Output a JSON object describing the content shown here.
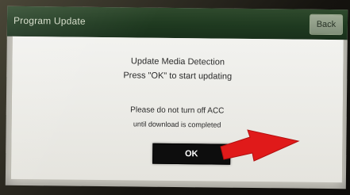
{
  "titlebar": {
    "title": "Program Update",
    "back_label": "Back"
  },
  "dialog": {
    "line1": "Update Media Detection",
    "line2": "Press \"OK\" to start updating",
    "line3": "Please do not turn off ACC",
    "line4": "until download is completed",
    "ok_label": "OK"
  },
  "colors": {
    "titlebar": "#1f3a20",
    "dialog_bg": "#f0f0ee",
    "ok_button": "#0d0d0d",
    "arrow": "#e01a1a"
  },
  "icons": {
    "annotation": "red-arrow-icon"
  }
}
